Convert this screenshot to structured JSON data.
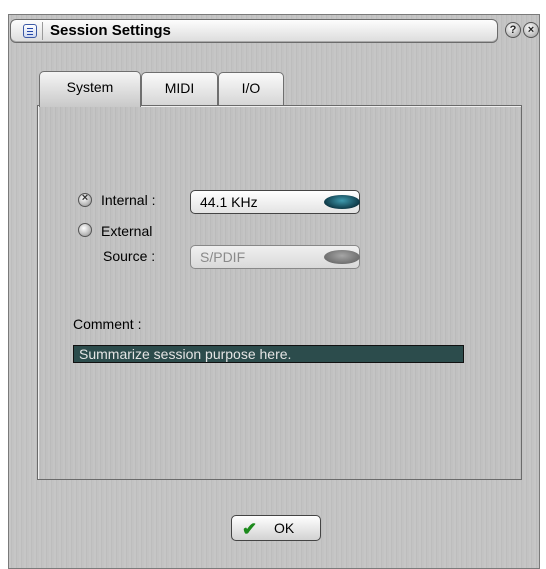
{
  "window": {
    "title": "Session Settings"
  },
  "title_buttons": {
    "help": "?",
    "close": "×"
  },
  "tabs": [
    {
      "label": "System",
      "active": true
    },
    {
      "label": "MIDI",
      "active": false
    },
    {
      "label": "I/O",
      "active": false
    }
  ],
  "clock": {
    "internal_label": "Internal :",
    "internal_selected": true,
    "internal_value": "44.1 KHz",
    "external_label_line1": "External",
    "external_label_line2": "Source :",
    "external_selected": false,
    "external_value": "S/PDIF"
  },
  "comment": {
    "label": "Comment :",
    "value": "Summarize session purpose here."
  },
  "footer": {
    "ok_label": "OK"
  },
  "colors": {
    "comment_bg": "#2c4c4c",
    "knob": "#1f6a7c",
    "ok_check": "#1c8a1c"
  }
}
